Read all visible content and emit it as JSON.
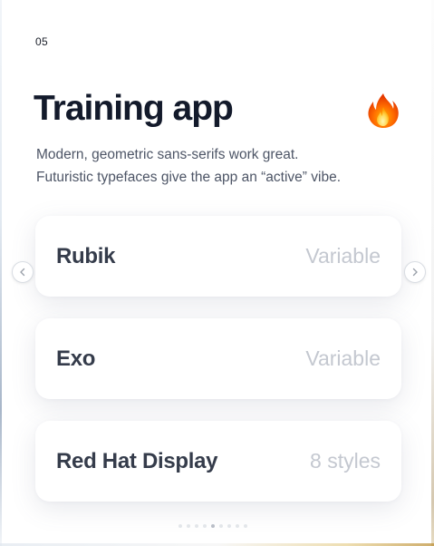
{
  "slide": {
    "number": "05",
    "title": "Training app",
    "description_lines": [
      "Modern, geometric sans-serifs work great.",
      "Futuristic typefaces give the app an “active” vibe."
    ],
    "emoji_icon": "fire-icon"
  },
  "fonts": [
    {
      "name": "Rubik",
      "styles": "Variable"
    },
    {
      "name": "Exo",
      "styles": "Variable"
    },
    {
      "name": "Red Hat Display",
      "styles": "8 styles"
    }
  ],
  "navigation": {
    "prev_icon": "chevron-left-icon",
    "next_icon": "chevron-right-icon",
    "pager_count": 9,
    "pager_active_index": 4
  },
  "colors": {
    "title": "#131a2b",
    "body_text": "#4d5566",
    "font_name": "#353c4b",
    "styles_text": "#c4c8d0",
    "card_bg": "#ffffff"
  }
}
